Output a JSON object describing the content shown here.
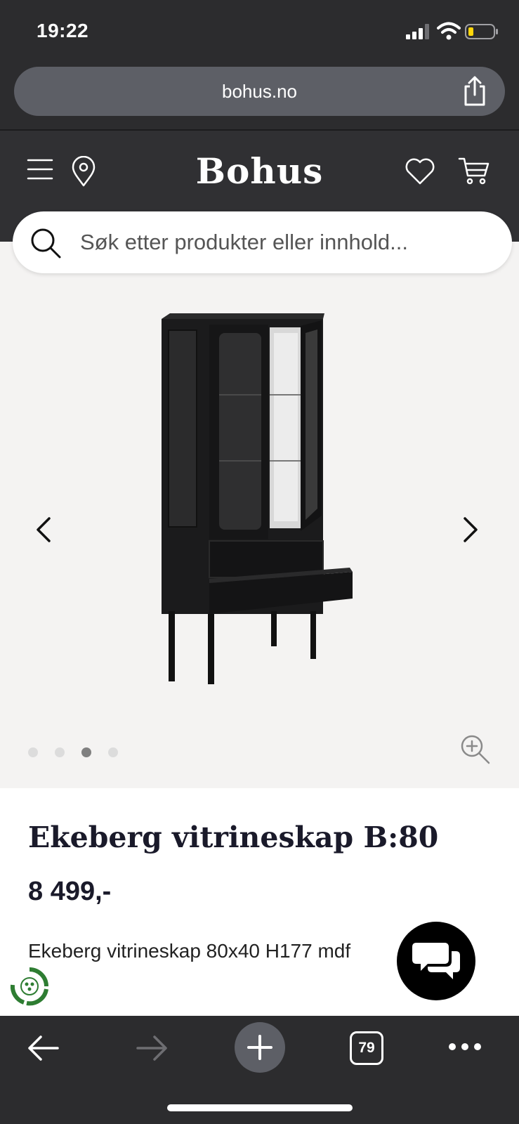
{
  "status_bar": {
    "time": "19:22",
    "icons": [
      "cellular-signal-icon",
      "wifi-icon",
      "battery-low-icon"
    ]
  },
  "browser": {
    "url": "bohus.no",
    "tab_count": "79",
    "icons": [
      "share-icon",
      "back-arrow-icon",
      "forward-arrow-icon",
      "plus-icon",
      "tabs-icon",
      "more-icon"
    ]
  },
  "header": {
    "logo": "Bohus",
    "icons": [
      "menu-icon",
      "location-pin-icon",
      "heart-icon",
      "cart-icon"
    ]
  },
  "search": {
    "placeholder": "Søk etter produkter eller innhold..."
  },
  "gallery": {
    "image_count": 4,
    "active_index": 2,
    "icons": [
      "chevron-left-icon",
      "chevron-right-icon",
      "zoom-in-icon"
    ]
  },
  "product": {
    "title": "Ekeberg vitrineskap B:80",
    "price": "8 499,-",
    "description": "Ekeberg vitrineskap 80x40 H177 mdf"
  },
  "floating": {
    "icons": [
      "eco-badge-icon",
      "chat-icon"
    ]
  },
  "colors": {
    "chrome_bg": "#2c2c2e",
    "header_bg": "#303033",
    "gallery_bg": "#f4f3f2",
    "text_dark": "#1a1a2a",
    "eco_green": "#2e7d32"
  }
}
